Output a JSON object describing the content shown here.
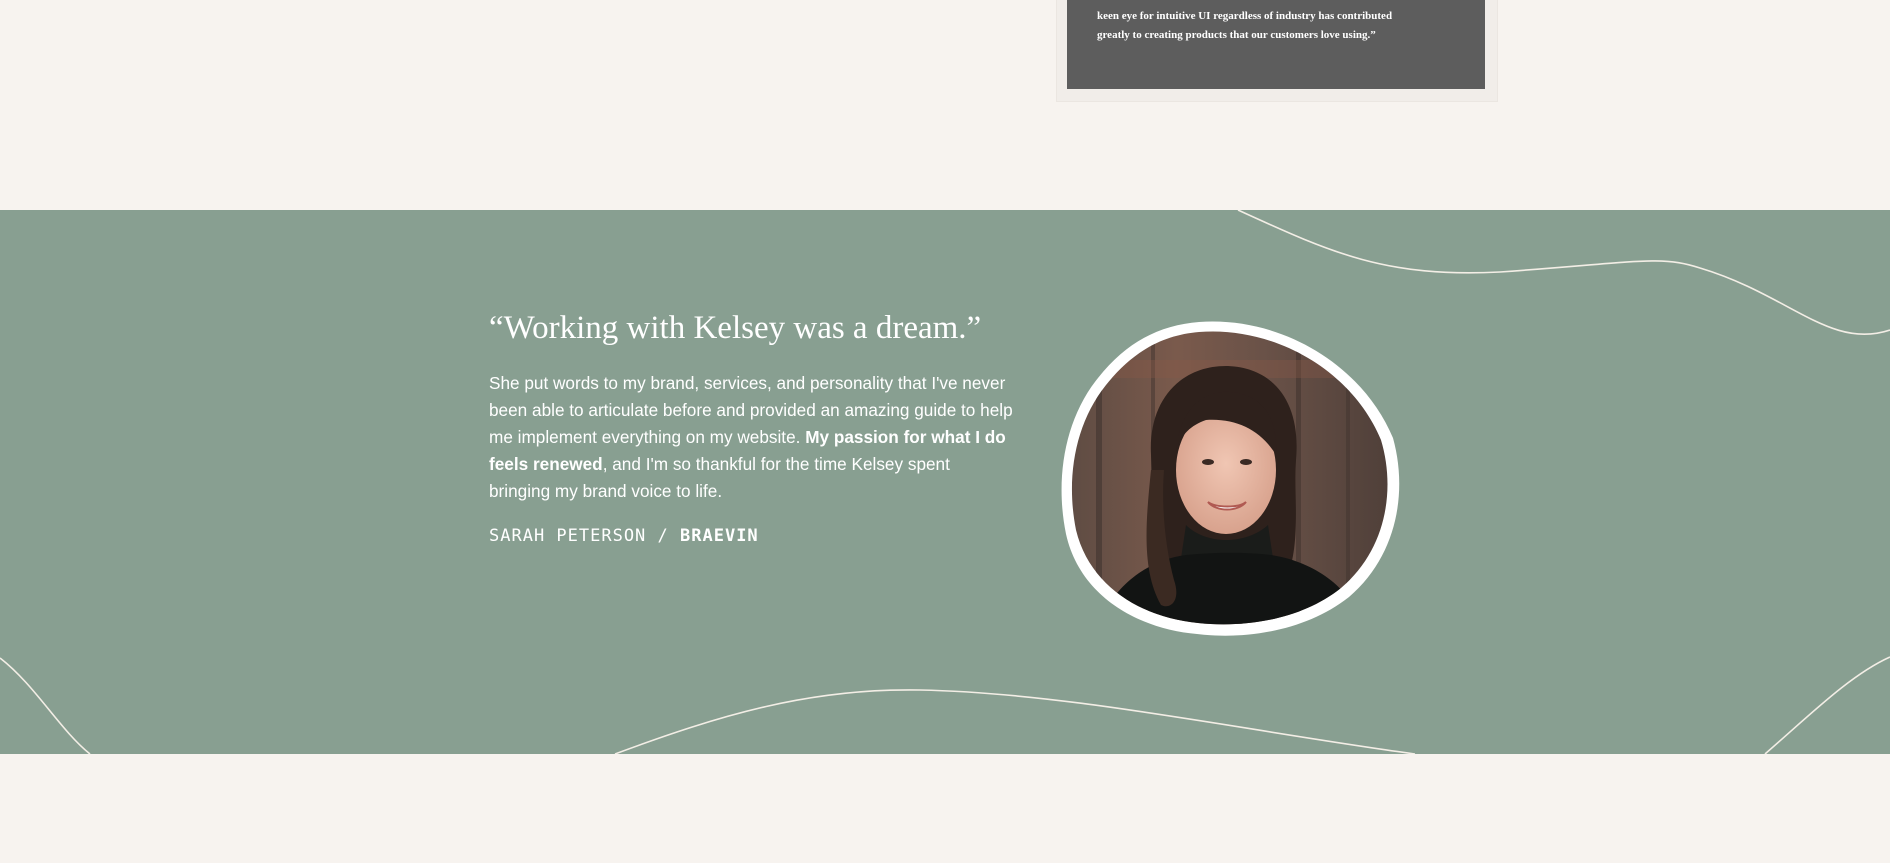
{
  "previous_testimonial": {
    "text": "keen eye for intuitive UI regardless of industry has contributed greatly to creating products that our customers love using.”"
  },
  "testimonial": {
    "headline": "“Working with Kelsey was a dream.”",
    "body_part1": "She put words to my brand, services, and personality that I've never been able to articulate before and provided an amazing guide to help me implement everything on my website. ",
    "body_emphasis": "My passion for what I do feels renewed",
    "body_part2": ", and I'm so thankful for the time Kelsey spent bringing my brand voice to life.",
    "author": "SARAH PETERSON",
    "separator": " / ",
    "company": "BRAEVIN",
    "photo_icon": "portrait-photo"
  },
  "colors": {
    "page_background": "#f7f3ef",
    "band_background": "#889f91",
    "card_background": "#5d5d5d",
    "line_color": "#f3eee6",
    "text": "#ffffff"
  }
}
